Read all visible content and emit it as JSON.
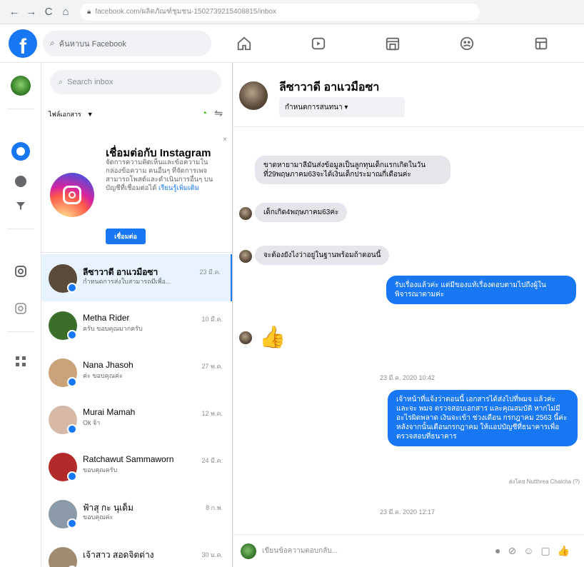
{
  "browser": {
    "back": "←",
    "forward": "→",
    "reload": "C",
    "home": "⌂",
    "url": "facebook.com/ผลิตภัณฑ์ชุมชน-1502739215408815/inbox"
  },
  "fbbar": {
    "search_placeholder": "ค้นหาบน Facebook",
    "nav_icons": [
      "home-icon",
      "video-icon",
      "marketplace-icon",
      "groups-icon",
      "gaming-icon"
    ]
  },
  "rail": {
    "icons": [
      "page-avatar",
      "messenger-icon",
      "messenger-alt-icon",
      "filter-icon",
      "instagram-icon",
      "instagram-alt-icon",
      "apps-icon"
    ]
  },
  "inbox": {
    "search_placeholder": "Search inbox",
    "filter_label": "ไฟล์เอกสาร",
    "promo": {
      "title": "เชื่อมต่อกับ Instagram",
      "body": "จัดการความคิดเห็นและข้อความในกล่องข้อความ คนอื่นๆ ที่จัดการเพจสามารถโพสต์และดำเนินการอื่นๆ บนบัญชีที่เชื่อมต่อได้",
      "link": "เรียนรู้เพิ่มเติม",
      "button": "เชื่อมต่อ"
    },
    "conversations": [
      {
        "name": "ลีซาวาดี อาแวมือซา",
        "preview": "กำหนดการส่งใบสามารถมีเพื่อ...",
        "time": "23 มี.ค.",
        "active": true,
        "bold": true,
        "avatar_color": "#5b4b3a"
      },
      {
        "name": "Metha Rider",
        "preview": "ครับ ขอบคุณมากครับ",
        "time": "10 มี.ค.",
        "active": false,
        "bold": false,
        "avatar_color": "#3b6e2a"
      },
      {
        "name": "Nana Jhasoh",
        "preview": "ค่ะ ขอบคุณค่ะ",
        "time": "27 พ.ค.",
        "active": false,
        "bold": false,
        "avatar_color": "#c9a27a"
      },
      {
        "name": "Murai Mamah",
        "preview": "Ok จ้า",
        "time": "12 พ.ค.",
        "active": false,
        "bold": false,
        "avatar_color": "#d7b9a8"
      },
      {
        "name": "Ratchawut Sammaworn",
        "preview": "ขอบคุณครับ",
        "time": "24 มี.ค.",
        "active": false,
        "bold": false,
        "avatar_color": "#b22a2a"
      },
      {
        "name": "ฟ้าสุ กะ นุเด็ม",
        "preview": "ขอบคุณค่ะ",
        "time": "8 ก.พ.",
        "active": false,
        "bold": false,
        "avatar_color": "#8a9aa8"
      },
      {
        "name": "เจ้าสาว สอดจิตต่าง",
        "preview": "",
        "time": "30 ม.ค.",
        "active": false,
        "bold": false,
        "avatar_color": "#a08a70"
      }
    ]
  },
  "chat": {
    "header_name": "ลีซาวาดี อาแวมือซา",
    "header_filter": "กำหนดการสนทนา ▾",
    "messages_in": [
      "ขาดหายามาลีมันส่งข้อมูลเป็นลูกทุนเด็กแรกเกิดในวันที่29พฤษภาคม63จะได้เงินเด็กประมาณกี่เดือนค่ะ",
      "เด็กเกิด4พฤษภาคม63ค่ะ",
      "จะต้องยังไงว่าอยู่ในฐานพร้อมถ้าตอนนี้"
    ],
    "messages_out": [
      "รับเรื่องแล้วค่ะ แต่มีของแท้เรื่องตอบตามไปถึงผู้ในพิจารณาตามค่ะ",
      "เจ้าหน้าที่แจ้งว่าตอนนี้ เอกสารได้ส่งไปที่พมจ แล้วค่ะ และจะ พมจ ตรวจสอบเอกสาร และคุณสมบัติ หากไม่มีอะไรผิดพลาด เงินจะเข้า ช่วงเดือน กรกฎาคม 2563 นี้ค่ะ หลังจากนั้นเดือนกรกฎาคม ให้แอปบัญชีที่ธนาคารเพื่อตรวจสอบที่ธนาคาร"
    ],
    "timestamp_1": "23 มี.ค. 2020 10:42",
    "timestamp_2": "23 มี.ค. 2020 12:17",
    "sent_by": "ส่งโดย Nutthrea Chaicha (?)",
    "thumb": "👍",
    "composer_placeholder": "เขียนข้อความตอบกลับ...",
    "composer_icons": [
      "attach-icon",
      "link-icon",
      "emoji-icon",
      "image-icon",
      "like-icon"
    ]
  }
}
